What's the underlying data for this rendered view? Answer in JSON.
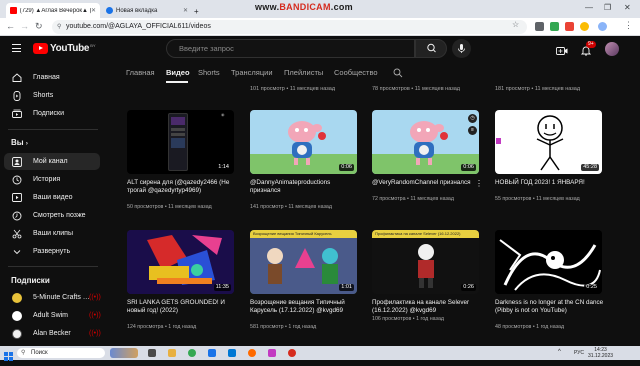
{
  "browser": {
    "tabs": [
      {
        "label": "(729) ▲Аглая Вечерок▲ (20…",
        "active": true,
        "favicon_color": "#ff0000"
      },
      {
        "label": "Новая вкладка",
        "active": false,
        "favicon_color": "#1a73e8"
      }
    ],
    "recorder_watermark": {
      "prefix": "www.",
      "brand": "BANDICAM",
      "suffix": ".com"
    },
    "url": "youtube.com/@AGLAYA_OFFICIAL611/videos",
    "window_controls": [
      "—",
      "❐",
      "✕"
    ]
  },
  "youtube": {
    "logo_text": "YouTube",
    "country_code": "BY",
    "search_placeholder": "Введите запрос",
    "notification_count": "9+"
  },
  "sidebar": {
    "main": [
      {
        "label": "Главная",
        "icon": "home-icon"
      },
      {
        "label": "Shorts",
        "icon": "shorts-icon"
      },
      {
        "label": "Подписки",
        "icon": "subscriptions-icon"
      }
    ],
    "you_title": "Вы",
    "you_items": [
      {
        "label": "Мой канал",
        "icon": "channel-icon",
        "active": true
      },
      {
        "label": "История",
        "icon": "history-icon"
      },
      {
        "label": "Ваши видео",
        "icon": "your-videos-icon"
      },
      {
        "label": "Смотреть позже",
        "icon": "watch-later-icon"
      },
      {
        "label": "Ваши клипы",
        "icon": "clips-icon"
      },
      {
        "label": "Развернуть",
        "icon": "chevron-down-icon"
      }
    ],
    "subs_title": "Подписки",
    "subscriptions": [
      {
        "label": "5-Minute Crafts …",
        "avatar_color": "#e8c23a"
      },
      {
        "label": "Adult Swim",
        "avatar_color": "#ffffff"
      },
      {
        "label": "Alan Becker",
        "avatar_color": "#f1f1f1"
      }
    ]
  },
  "channel_tabs": [
    "Главная",
    "Видео",
    "Shorts",
    "Трансляции",
    "Плейлисты",
    "Сообщество"
  ],
  "active_tab": "Видео",
  "top_row_meta": [
    "101 просмотр • 11 месяцев назад",
    "78 просмотров • 11 месяцев назад",
    "181 просмотр • 11 месяцев назад"
  ],
  "videos": [
    {
      "title": "ALT сирена для (@qazedy2466 (Не трогай @qazedyrtyp4969)",
      "meta": "50 просмотров • 11 месяцев назад",
      "duration": "1:14"
    },
    {
      "title": "@DannyAnimateproductions признался",
      "meta": "141 просмотр • 11 месяцев назад",
      "duration": "0:06"
    },
    {
      "title": "@VeryRandomChannel признался",
      "meta": "72 просмотра • 11 месяцев назад",
      "duration": "0:06"
    },
    {
      "title": "НОВЫЙ ГОД 2023! 1 ЯНВАРЯ!",
      "meta": "55 просмотров • 11 месяцев назад",
      "duration": "45:28"
    },
    {
      "title": "SRI LANKA GETS GROUNDED! И новый год! (2022)",
      "meta": "124 просмотра • 1 год назад",
      "duration": "11:35"
    },
    {
      "title": "Возрощение вещания Типичный Карусель (17.12.2022) @kvgd69",
      "meta": "581 просмотр • 1 год назад",
      "duration": "1:01",
      "thumb_caption": "Возрощение вещания Типичный Карусель"
    },
    {
      "title": "Профилактика на канале Selever (16.12.2022) @kvgd69",
      "meta": "106 просмотров • 1 год назад",
      "duration": "0:26",
      "thumb_caption": "Профилактика на канале Selever (16.12.2022)"
    },
    {
      "title": "Darkness is no longer at the CN dance (Pibby is not on YouTube)",
      "meta": "48 просмотров • 1 год назад",
      "duration": "0:25"
    }
  ],
  "taskbar": {
    "search_label": "Поиск",
    "lang": "РУС",
    "time": "14:23",
    "date": "31.12.2023"
  }
}
